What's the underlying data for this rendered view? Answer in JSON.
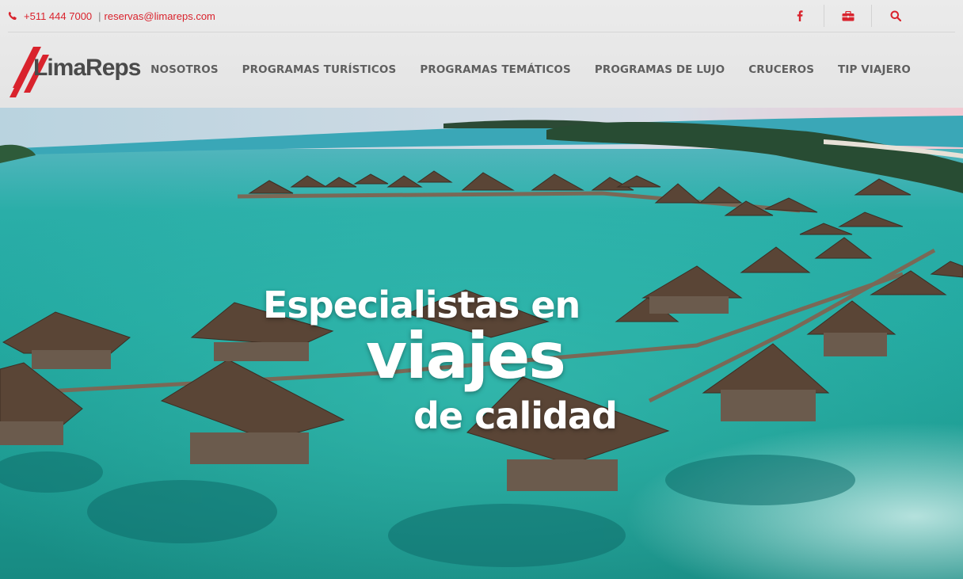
{
  "topbar": {
    "phone": "+511 444 7000",
    "separator": "|",
    "email": "reservas@limareps.com",
    "icons": [
      "phone-icon",
      "facebook-icon",
      "briefcase-icon",
      "search-icon"
    ],
    "accent_color": "#d9232d"
  },
  "logo": {
    "text_lima": "Lima",
    "text_reps": "Reps"
  },
  "nav": {
    "items": [
      {
        "label": "NOSOTROS"
      },
      {
        "label": "PROGRAMAS TURÍSTICOS"
      },
      {
        "label": "PROGRAMAS TEMÁTICOS"
      },
      {
        "label": "PROGRAMAS DE LUJO"
      },
      {
        "label": "CRUCEROS"
      },
      {
        "label": "TIP VIAJERO"
      }
    ],
    "text_color": "#5f5f5f"
  },
  "hero": {
    "line1": "Especialistas en",
    "line2": "viajes",
    "line3": "de calidad",
    "water_color": "#22a8a0"
  }
}
